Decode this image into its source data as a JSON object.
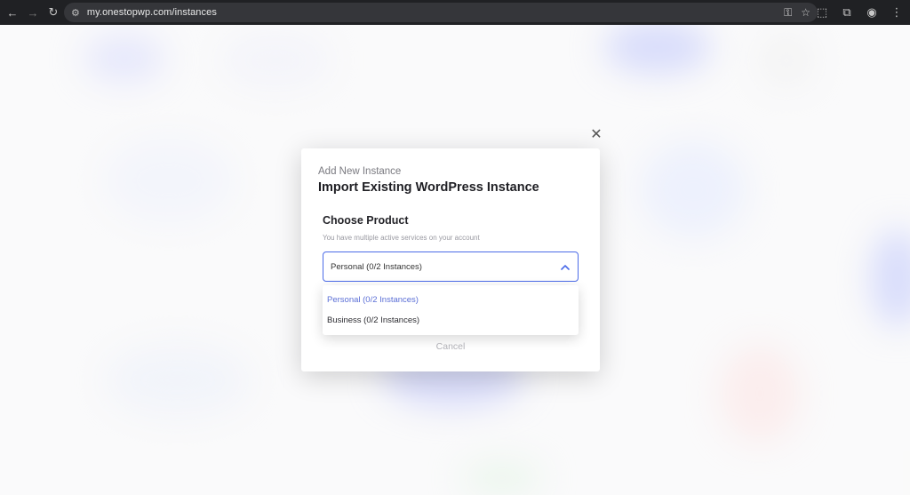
{
  "browser": {
    "url": "my.onestopwp.com/instances",
    "icons": [
      "back-icon",
      "forward-icon",
      "reload-icon",
      "tune-icon",
      "key-icon",
      "star-icon",
      "extensions-icon",
      "sync-icon",
      "profile-icon",
      "more-icon"
    ]
  },
  "modal": {
    "eyebrow": "Add New Instance",
    "title": "Import Existing WordPress Instance",
    "section_title": "Choose Product",
    "section_subtitle": "You have multiple active services on your account",
    "select": {
      "value": "Personal (0/2 Instances)"
    },
    "options": [
      {
        "label": "Personal (0/2 Instances)",
        "selected": true
      },
      {
        "label": "Business (0/2 Instances)",
        "selected": false
      }
    ],
    "cancel_label": "Cancel"
  },
  "colors": {
    "accent": "#4b6be8",
    "selected_option": "#5b6fd6",
    "chrome_bg": "#202124"
  }
}
